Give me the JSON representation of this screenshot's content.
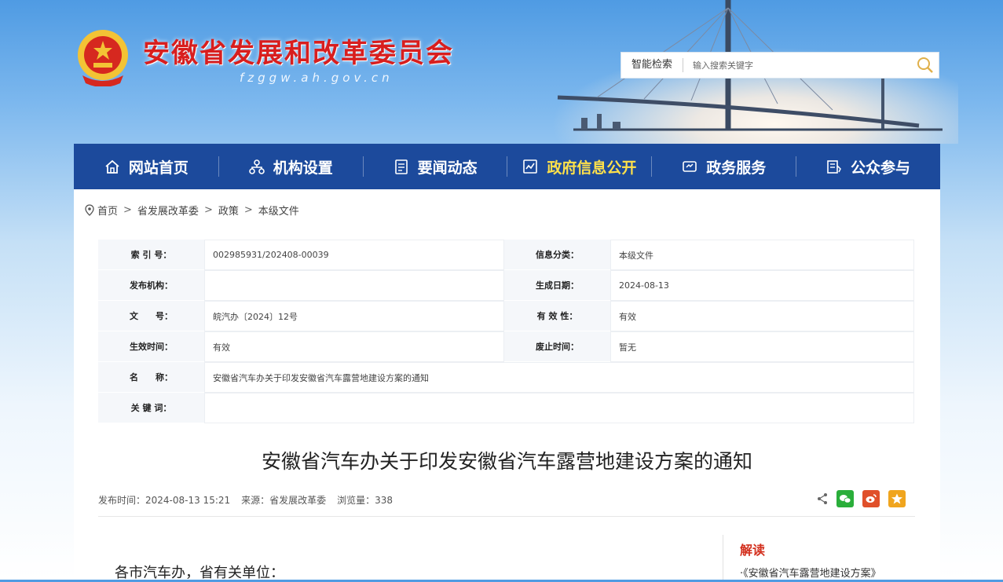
{
  "header": {
    "site_title": "安徽省发展和改革委员会",
    "site_domain": "fzggw.ah.gov.cn",
    "search": {
      "label": "智能检索",
      "placeholder": "输入搜索关键字"
    }
  },
  "nav": {
    "items": [
      {
        "label": "网站首页",
        "icon": "home-icon"
      },
      {
        "label": "机构设置",
        "icon": "org-chart-icon"
      },
      {
        "label": "要闻动态",
        "icon": "document-icon"
      },
      {
        "label": "政府信息公开",
        "icon": "info-disclosure-icon",
        "active": true
      },
      {
        "label": "政务服务",
        "icon": "service-icon"
      },
      {
        "label": "公众参与",
        "icon": "participation-icon"
      }
    ],
    "active_color": "#ffe14a",
    "bar_color": "#1c4a9c"
  },
  "breadcrumb": [
    "首页",
    "省发展改革委",
    "政策",
    "本级文件"
  ],
  "info": {
    "index_no_label": "索 引 号：",
    "index_no": "002985931/202408-00039",
    "category_label": "信息分类：",
    "category": "本级文件",
    "publisher_label": "发布机构：",
    "publisher": "",
    "gen_date_label": "生成日期：",
    "gen_date": "2024-08-13",
    "doc_no_label": "文　　号：",
    "doc_no": "皖汽办〔2024〕12号",
    "validity_label": "有 效 性：",
    "validity": "有效",
    "effective_label": "生效时间：",
    "effective": "有效",
    "expiry_label": "废止时间：",
    "expiry": "暂无",
    "name_label": "名　　称：",
    "name": "安徽省汽车办关于印发安徽省汽车露营地建设方案的通知",
    "keywords_label": "关 键 词：",
    "keywords": ""
  },
  "article": {
    "title": "安徽省汽车办关于印发安徽省汽车露营地建设方案的通知",
    "publish_time": "发布时间：2024-08-13 15:21",
    "source": "来源：省发展改革委",
    "views": "浏览量：338",
    "salutation": "各市汽车办，省有关单位："
  },
  "sidebar": {
    "title": "解读",
    "item": "·《安徽省汽车露营地建设方案》"
  }
}
